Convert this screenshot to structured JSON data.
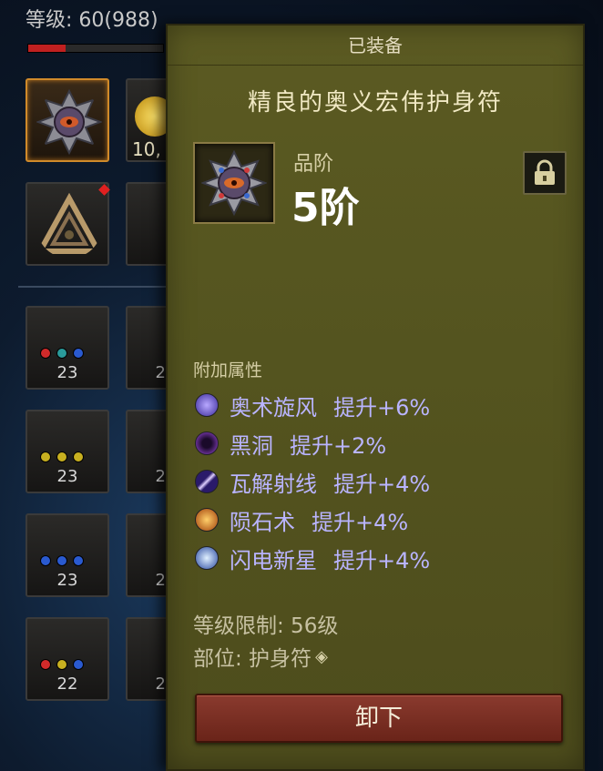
{
  "background": {
    "level_text": "等级: 60(988)",
    "xp_progress": 0.28,
    "gold_text": "10,",
    "slot_counts": [
      "23",
      "23",
      "23",
      "22"
    ],
    "slot_counts_partial": [
      "2",
      "2",
      "2",
      "2"
    ]
  },
  "tooltip": {
    "header": "已装备",
    "item_name": "精良的奥义宏伟护身符",
    "grade_label": "品阶",
    "grade_value": "5阶",
    "lock_icon": "lock-icon",
    "section_label": "附加属性",
    "attributes": [
      {
        "name": "奥术旋风",
        "bonus": "提升+6%",
        "icon": "arcane-vortex-icon",
        "color": "#6a5cff"
      },
      {
        "name": "黑洞",
        "bonus": "提升+2%",
        "icon": "black-hole-icon",
        "color": "#8a3acc"
      },
      {
        "name": "瓦解射线",
        "bonus": "提升+4%",
        "icon": "disintegrate-icon",
        "color": "#7a5ae8"
      },
      {
        "name": "陨石术",
        "bonus": "提升+4%",
        "icon": "meteor-icon",
        "color": "#d07a20"
      },
      {
        "name": "闪电新星",
        "bonus": "提升+4%",
        "icon": "lightning-nova-icon",
        "color": "#5a8aff"
      }
    ],
    "level_requirement": "等级限制:  56级",
    "slot_label": "部位: 护身符",
    "unequip_button": "卸下"
  },
  "colors": {
    "panel_bg": "#56551f",
    "attribute_text": "#b9b4ff",
    "button_bg": "#7a2e22",
    "selected_border": "#d08a2a"
  }
}
